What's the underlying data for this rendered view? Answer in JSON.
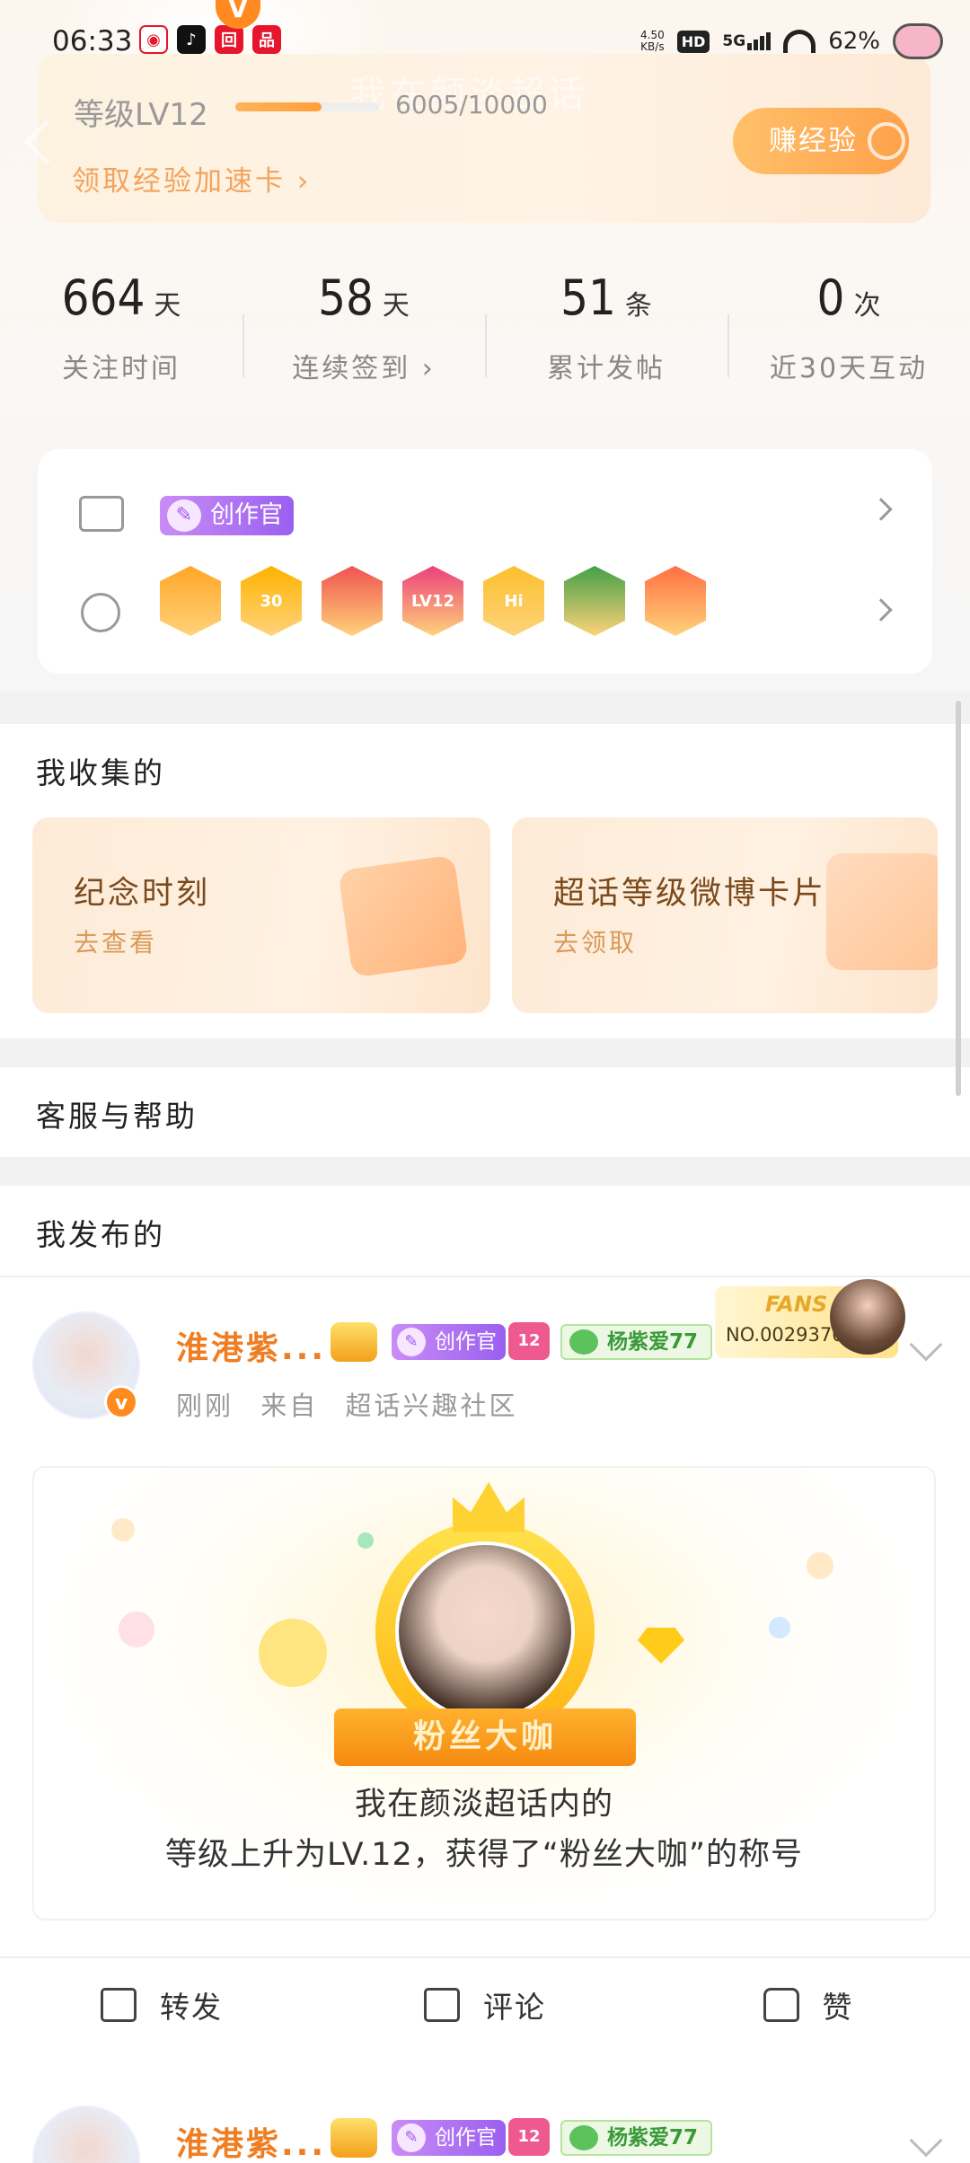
{
  "status_bar": {
    "time": "06:33",
    "network_speed": "4.50\nKB/s",
    "hd": "HD",
    "signal": "5G",
    "battery": "62%",
    "app_badge": "V"
  },
  "header": {
    "ghost_title": "我在颜淡超话",
    "level_label": "等级LV12",
    "progress_value": 6005,
    "progress_max": 10000,
    "progress_text": "6005/10000",
    "speedup_link": "领取经验加速卡 ›",
    "earn_button": "赚经验"
  },
  "stats": [
    {
      "value": "664",
      "unit": "天",
      "label": "关注时间"
    },
    {
      "value": "58",
      "unit": "天",
      "label": "连续签到 ›"
    },
    {
      "value": "51",
      "unit": "条",
      "label": "累计发帖"
    },
    {
      "value": "0",
      "unit": "次",
      "label": "近30天互动"
    }
  ],
  "badges": {
    "creator_tag": "创作官",
    "medals": [
      {
        "name": "crown-medal",
        "text": "",
        "color": "#ffa726"
      },
      {
        "name": "30-days-medal",
        "text": "30",
        "color": "#ffb300"
      },
      {
        "name": "character-medal",
        "text": "",
        "color": "#ef5350"
      },
      {
        "name": "lv12-medal",
        "text": "LV12",
        "color": "#ec407a"
      },
      {
        "name": "hi-medal",
        "text": "Hi",
        "color": "#fbc02d"
      },
      {
        "name": "hand-medal",
        "text": "",
        "color": "#43a047"
      },
      {
        "name": "rock-hand-medal",
        "text": "",
        "color": "#ff7043"
      }
    ]
  },
  "collect": {
    "title": "我收集的",
    "cards": [
      {
        "title": "纪念时刻",
        "sub": "去查看"
      },
      {
        "title": "超话等级微博卡片",
        "sub": "去领取"
      }
    ]
  },
  "help": {
    "title": "客服与帮助"
  },
  "published": {
    "title": "我发布的",
    "post": {
      "username": "淮港紫...",
      "creator_tag": "创作官",
      "gem_level": "12",
      "fan_tag": "杨紫爱77",
      "fans_label": "FANS",
      "fans_no": "NO.0029370",
      "time": "刚刚",
      "source_prefix": "来自",
      "source": "超话兴趣社区",
      "ribbon": "粉丝大咖",
      "line1": "我在颜淡超话内的",
      "line2": "等级上升为LV.12，获得了“粉丝大咖”的称号"
    },
    "next_post": {
      "username": "淮港紫...",
      "creator_tag": "创作官",
      "gem_level": "12",
      "fan_tag": "杨紫爱77"
    }
  },
  "actions": {
    "repost": "转发",
    "comment": "评论",
    "like": "赞"
  },
  "colors": {
    "accent_orange": "#ef7d22",
    "earn_button": "#ffa14a",
    "creator_purple": "#9a5ff0"
  }
}
